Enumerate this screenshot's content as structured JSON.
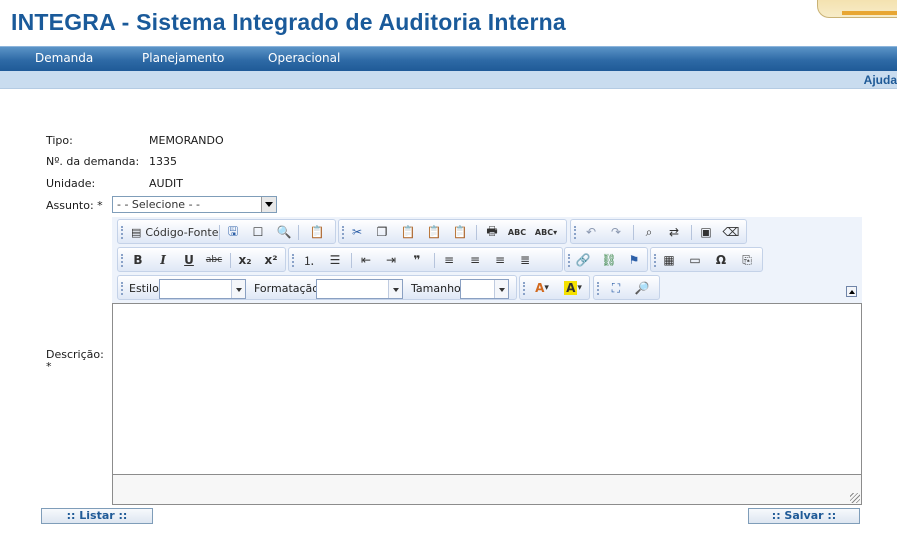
{
  "app": {
    "title": "INTEGRA - Sistema Integrado de Auditoria Interna"
  },
  "nav": {
    "items": [
      "Demanda",
      "Planejamento",
      "Operacional"
    ]
  },
  "subbar": {
    "help": "Ajuda"
  },
  "form": {
    "tipo_label": "Tipo:",
    "tipo_value": "MEMORANDO",
    "numero_label": "Nº. da demanda:",
    "numero_value": "1335",
    "unidade_label": "Unidade:",
    "unidade_value": "AUDIT",
    "assunto_label": "Assunto: *",
    "assunto_selected": "- - Selecione - -",
    "descricao_label": "Descrição:",
    "descricao_required": "*"
  },
  "editor": {
    "source_label": "Código-Fonte",
    "estilo_label": "Estilo",
    "formatacao_label": "Formatação",
    "tamanho_label": "Tamanho",
    "bold": "B",
    "italic": "I",
    "underline": "U",
    "strike": "abc",
    "subscript": "x₂",
    "superscript": "x²",
    "quote": "❞",
    "spell": "ABC",
    "omega": "Ω",
    "text_color": "A",
    "bg_color": "A"
  },
  "buttons": {
    "listar": ":: Listar ::",
    "salvar": ":: Salvar ::"
  },
  "colors": {
    "accent": "#1a5a9a",
    "nav": "#2e6aa6",
    "subbar": "#c9dcef"
  }
}
